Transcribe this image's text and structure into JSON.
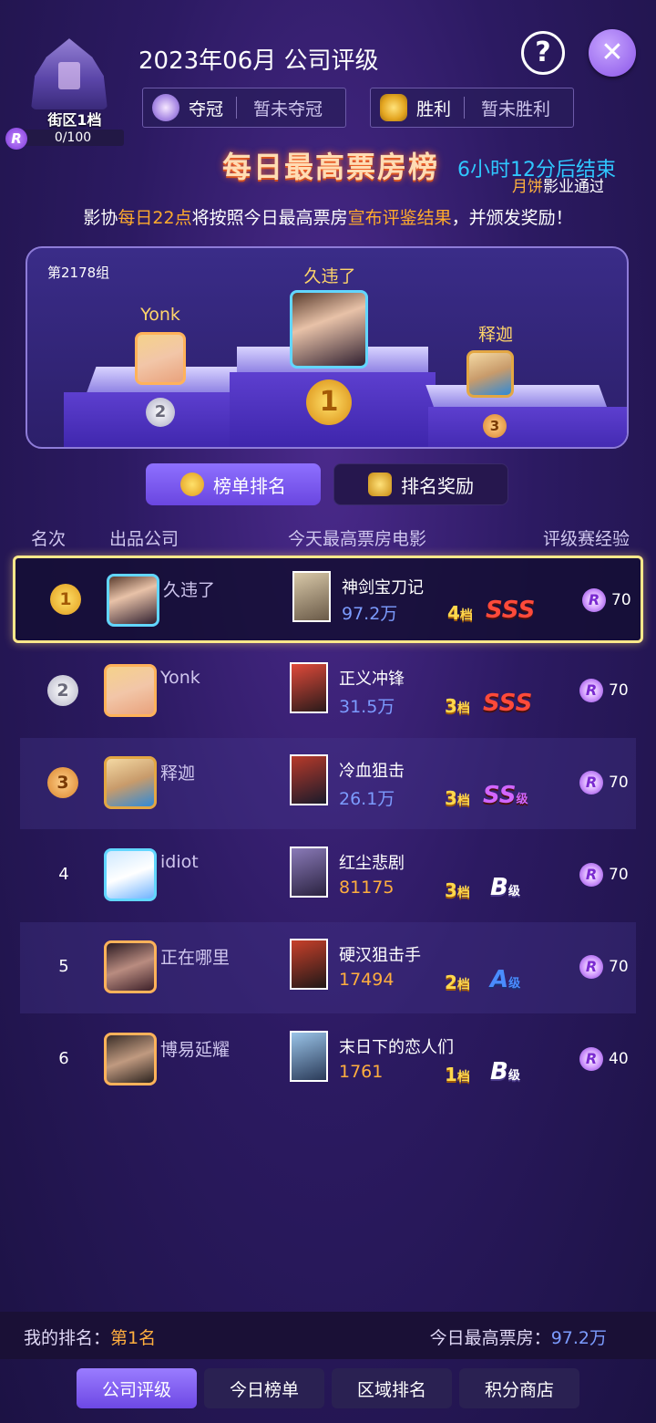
{
  "header": {
    "district_level": "街区1档",
    "district_progress": "0/100",
    "title": "2023年06月 公司评级",
    "crown_label": "夺冠",
    "crown_value": "暂未夺冠",
    "win_label": "胜利",
    "win_value": "暂未胜利",
    "help_symbol": "?",
    "close_symbol": "✕",
    "r_badge": "R"
  },
  "board": {
    "title": "每日最高票房榜",
    "countdown": "6小时12分后结束",
    "ticker_highlight": "月饼",
    "ticker_text": "影业通过",
    "notice_before": "影协",
    "notice_hl1": "每日22点",
    "notice_mid": "将按照今日最高票房",
    "notice_hl2": "宣布评鉴结果",
    "notice_after": "，并颁发奖励！"
  },
  "podium": {
    "group": "第2178组",
    "first": {
      "name": "久违了",
      "medal": "1"
    },
    "second": {
      "name": "Yonk",
      "medal": "2"
    },
    "third": {
      "name": "释迦",
      "medal": "3"
    }
  },
  "tabs": {
    "rank": "榜单排名",
    "reward": "排名奖励"
  },
  "table": {
    "headers": {
      "rank": "名次",
      "company": "出品公司",
      "movie": "今天最高票房电影",
      "exp": "评级赛经验"
    },
    "rows": [
      {
        "rank": "1",
        "company": "久违了",
        "movie": "神剑宝刀记",
        "box": "97.2万",
        "tier": "4",
        "grade": "SSS",
        "exp": "70"
      },
      {
        "rank": "2",
        "company": "Yonk",
        "movie": "正义冲锋",
        "box": "31.5万",
        "tier": "3",
        "grade": "SSS",
        "exp": "70"
      },
      {
        "rank": "3",
        "company": "释迦",
        "movie": "冷血狙击",
        "box": "26.1万",
        "tier": "3",
        "grade": "SS",
        "exp": "70"
      },
      {
        "rank": "4",
        "company": "idiot",
        "movie": "红尘悲剧",
        "box": "81175",
        "tier": "3",
        "grade": "B",
        "exp": "70"
      },
      {
        "rank": "5",
        "company": "正在哪里",
        "movie": "硬汉狙击手",
        "box": "17494",
        "tier": "2",
        "grade": "A",
        "exp": "70"
      },
      {
        "rank": "6",
        "company": "博易延耀",
        "movie": "末日下的恋人们",
        "box": "1761",
        "tier": "1",
        "grade": "B",
        "exp": "40"
      }
    ],
    "tier_suffix": "档",
    "grade_suffix": "级",
    "exp_icon": "R"
  },
  "footer": {
    "my_rank_label": "我的排名：",
    "my_rank_value": "第1名",
    "today_box_label": "今日最高票房：",
    "today_box_value": "97.2万"
  },
  "nav": {
    "company_rating": "公司评级",
    "today_board": "今日榜单",
    "region_rank": "区域排名",
    "points_shop": "积分商店"
  },
  "colors": {
    "background": "#2c1a62",
    "accent": "#7c5cf0",
    "highlight_orange": "#ffab2c",
    "highlight_blue": "#2fc8ff",
    "selected_border": "#ffe88a"
  },
  "icons": [
    "district-building-icon",
    "crown-icon",
    "trophy-icon",
    "help-icon",
    "close-icon",
    "medal-icon",
    "r-coin-icon",
    "poster-icon"
  ]
}
